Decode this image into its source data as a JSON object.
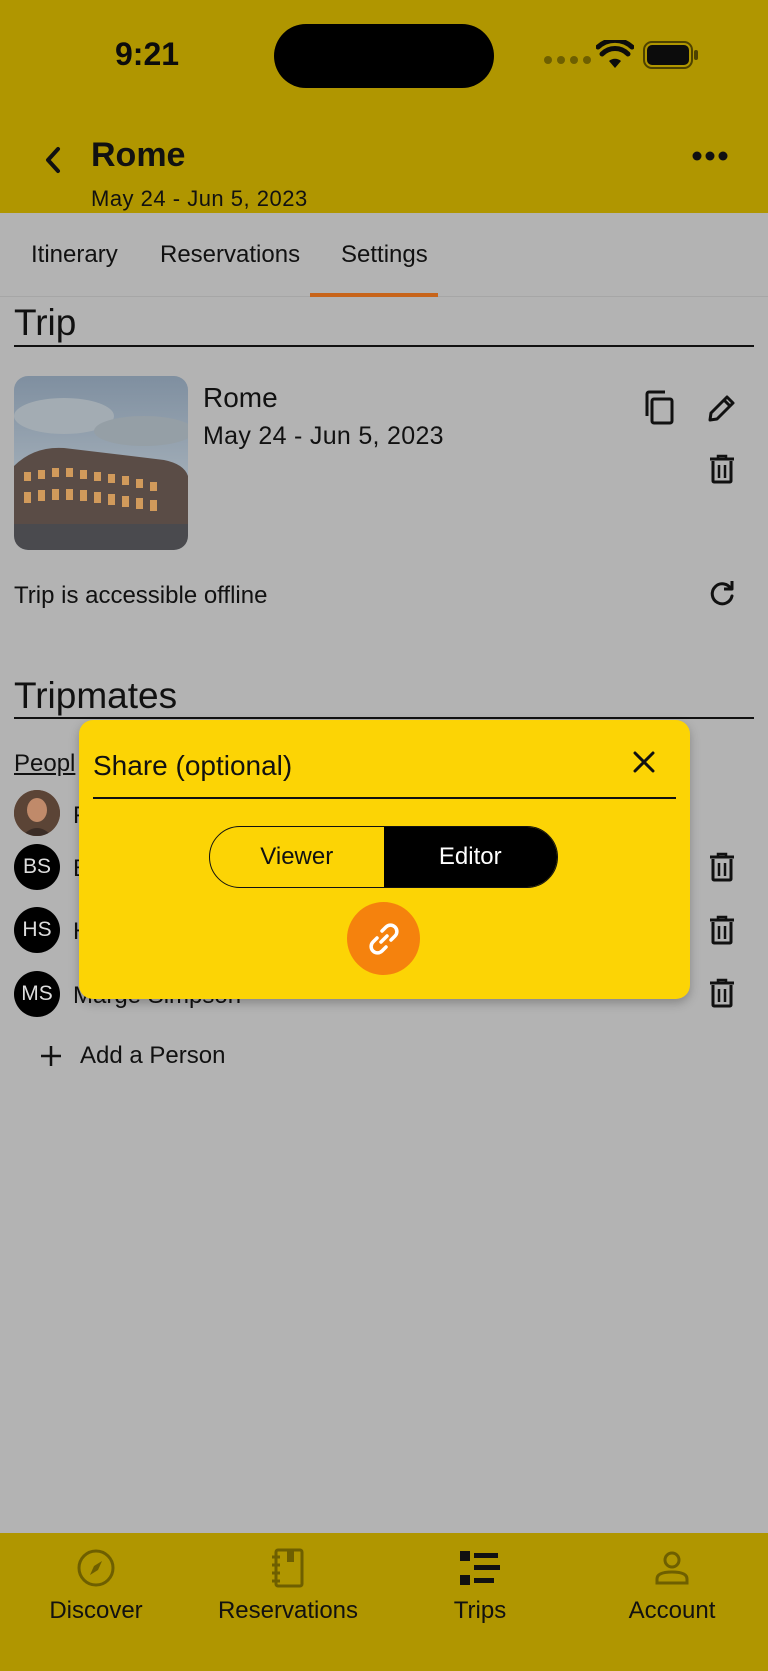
{
  "status_bar": {
    "time": "9:21"
  },
  "header": {
    "title": "Rome",
    "dates": "May 24 - Jun 5, 2023"
  },
  "tabs": [
    {
      "label": "Itinerary"
    },
    {
      "label": "Reservations"
    },
    {
      "label": "Settings",
      "active": true
    }
  ],
  "trip_section": {
    "title": "Trip",
    "card": {
      "name": "Rome",
      "dates": "May 24 - Jun 5, 2023"
    },
    "offline_text": "Trip is accessible offline"
  },
  "tripmates_section": {
    "title": "Tripmates",
    "people_label": "Peopl",
    "people": [
      {
        "initials": "",
        "name": "F",
        "photo": true
      },
      {
        "initials": "BS",
        "name": "B"
      },
      {
        "initials": "HS",
        "name": "H"
      },
      {
        "initials": "MS",
        "name": "Marge Simpson"
      }
    ],
    "add_person_label": "Add a Person"
  },
  "share_modal": {
    "title": "Share (optional)",
    "options": [
      "Viewer",
      "Editor"
    ],
    "selected": "Editor"
  },
  "bottom_nav": [
    {
      "label": "Discover",
      "icon": "compass-icon"
    },
    {
      "label": "Reservations",
      "icon": "notebook-icon"
    },
    {
      "label": "Trips",
      "icon": "list-icon"
    },
    {
      "label": "Account",
      "icon": "person-icon"
    }
  ],
  "colors": {
    "header_bg": "#b09600",
    "modal_bg": "#fcd405",
    "accent_orange": "#f5820d",
    "tab_underline": "#c7641a"
  }
}
